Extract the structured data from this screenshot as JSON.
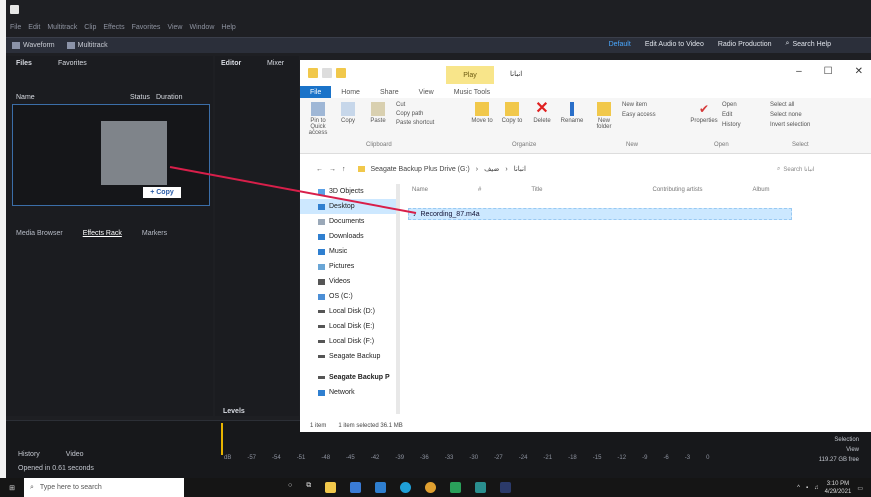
{
  "app": {
    "menus": [
      "File",
      "Edit",
      "Multitrack",
      "Clip",
      "Effects",
      "Favorites",
      "View",
      "Window",
      "Help"
    ],
    "toolbar": {
      "waveform": "Waveform",
      "multitrack": "Multitrack",
      "tabs": [
        "Default",
        "Edit Audio to Video",
        "Radio Production"
      ],
      "search": "Search Help"
    },
    "files_panel": {
      "tab1": "Files",
      "tab2": "Favorites",
      "col_name": "Name",
      "col_status": "Status",
      "col_duration": "Duration",
      "copy_badge": "+ Copy"
    },
    "editor_panel": {
      "tab1": "Editor",
      "tab2": "Mixer"
    },
    "lower_tabs": [
      "Media Browser",
      "Effects Rack",
      "Markers"
    ],
    "levels": "Levels",
    "timeline": {
      "tabs": [
        "History",
        "Video"
      ],
      "status": "Opened in 0.61 seconds",
      "ruler": [
        "dB",
        "-57",
        "-54",
        "-51",
        "-48",
        "-45",
        "-42",
        "-39",
        "-36",
        "-33",
        "-30",
        "-27",
        "-24",
        "-21",
        "-18",
        "-15",
        "-12",
        "-9",
        "-6",
        "-3",
        "0"
      ],
      "right_labels": [
        "Selection",
        "View"
      ],
      "right_value": "119.27 GB free"
    }
  },
  "explorer": {
    "play_tab": "Play",
    "folder_name": "انبانا",
    "ribbon_tabs": [
      "File",
      "Home",
      "Share",
      "View",
      "Music Tools"
    ],
    "ribbon": {
      "pin": "Pin to Quick access",
      "copy": "Copy",
      "paste": "Paste",
      "cut": "Cut",
      "copy_path": "Copy path",
      "paste_shortcut": "Paste shortcut",
      "move_to": "Move to",
      "copy_to": "Copy to",
      "delete": "Delete",
      "rename": "Rename",
      "new_folder": "New folder",
      "new_item": "New item",
      "easy_access": "Easy access",
      "properties": "Properties",
      "open": "Open",
      "edit": "Edit",
      "history": "History",
      "select_all": "Select all",
      "select_none": "Select none",
      "invert": "Invert selection",
      "groups": [
        "Clipboard",
        "Organize",
        "New",
        "Open",
        "Select"
      ]
    },
    "address": [
      "Seagate Backup Plus Drive (G:)",
      "ضيف",
      "انبانا"
    ],
    "search_placeholder": "Search انبانا",
    "nav": [
      "3D Objects",
      "Desktop",
      "Documents",
      "Downloads",
      "Music",
      "Pictures",
      "Videos",
      "OS (C:)",
      "Local Disk (D:)",
      "Local Disk (E:)",
      "Local Disk (F:)",
      "Seagate Backup",
      "Seagate Backup P",
      "Network"
    ],
    "columns": [
      "Name",
      "#",
      "Title",
      "Contributing artists",
      "Album"
    ],
    "file": "Recording_87.m4a",
    "status_items": "1 item",
    "status_selected": "1 item selected 36.1 MB"
  },
  "taskbar": {
    "search_placeholder": "Type here to search",
    "time": "3:10 PM",
    "date": "4/29/2021"
  }
}
